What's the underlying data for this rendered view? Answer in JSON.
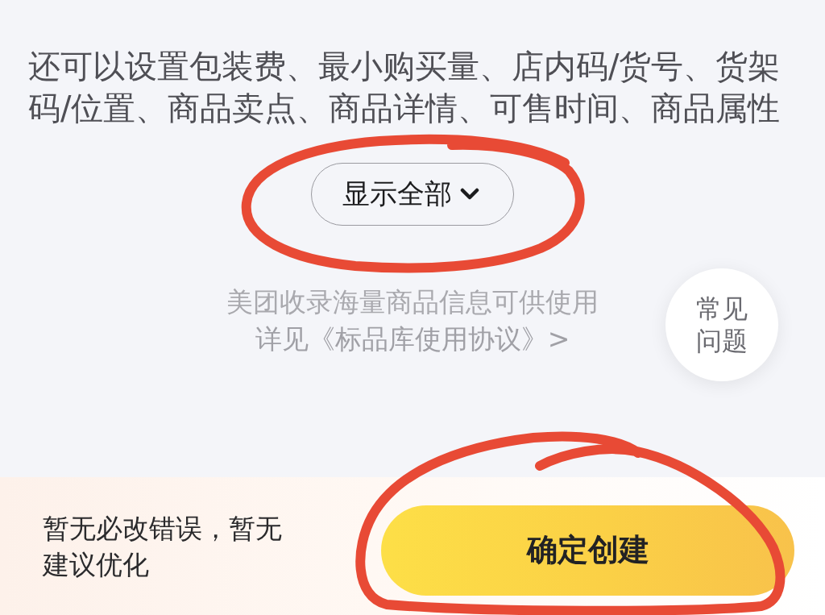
{
  "description": "还可以设置包装费、最小购买量、店内码/货号、货架码/位置、商品卖点、商品详情、可售时间、商品属性",
  "expand_button": {
    "label": "显示全部",
    "annotated": true
  },
  "notice": {
    "text": "美团收录海量商品信息可供使用",
    "link": "详见《标品库使用协议》>"
  },
  "faq_button": {
    "label": "常见问题"
  },
  "footer": {
    "status": "暂无必改错误，暂无建议优化",
    "confirm_button": {
      "label": "确定创建",
      "annotated": true
    }
  }
}
